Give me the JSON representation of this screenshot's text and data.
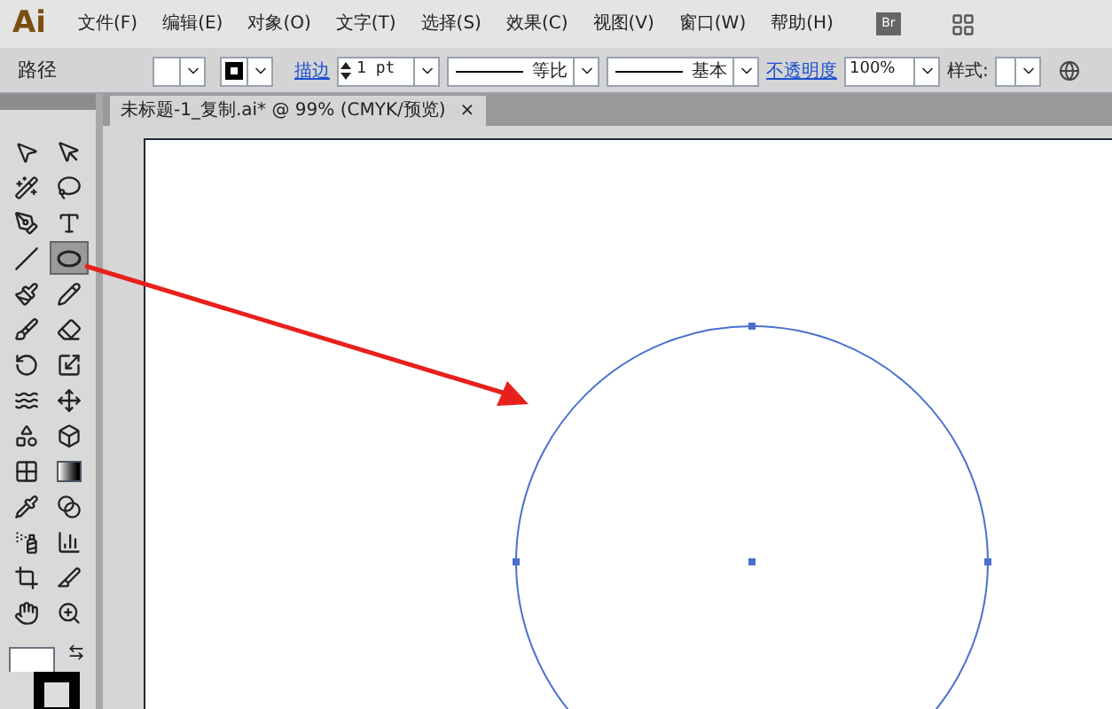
{
  "app_logo": "Ai",
  "menu": [
    "文件(F)",
    "编辑(E)",
    "对象(O)",
    "文字(T)",
    "选择(S)",
    "效果(C)",
    "视图(V)",
    "窗口(W)",
    "帮助(H)"
  ],
  "bridge_button": "Br",
  "control_bar": {
    "selection_label": "路径",
    "stroke_link": "描边",
    "stroke_weight": "1 pt",
    "profile": "等比",
    "brush": "基本",
    "opacity_link": "不透明度",
    "opacity": "100%",
    "style_label": "样式:"
  },
  "document_tab": {
    "title": "未标题-1_复制.ai* @ 99% (CMYK/预览)",
    "close": "×",
    "selected": true
  },
  "tools": [
    {
      "kind": "selection",
      "selected": false
    },
    {
      "kind": "direct-selection",
      "selected": false
    },
    {
      "kind": "magic-wand",
      "selected": false
    },
    {
      "kind": "lasso",
      "selected": false
    },
    {
      "kind": "pen",
      "selected": false
    },
    {
      "kind": "type",
      "selected": false
    },
    {
      "kind": "line",
      "selected": false
    },
    {
      "kind": "ellipse",
      "selected": true
    },
    {
      "kind": "paintbrush",
      "selected": false
    },
    {
      "kind": "pencil",
      "selected": false
    },
    {
      "kind": "blob-brush",
      "selected": false
    },
    {
      "kind": "eraser",
      "selected": false
    },
    {
      "kind": "rotate",
      "selected": false
    },
    {
      "kind": "scale",
      "selected": false
    },
    {
      "kind": "warp",
      "selected": false
    },
    {
      "kind": "free-transform",
      "selected": false
    },
    {
      "kind": "shape-builder",
      "selected": false
    },
    {
      "kind": "perspective",
      "selected": false
    },
    {
      "kind": "mesh",
      "selected": false
    },
    {
      "kind": "gradient",
      "selected": false
    },
    {
      "kind": "eyedropper",
      "selected": false
    },
    {
      "kind": "blend",
      "selected": false
    },
    {
      "kind": "symbol-sprayer",
      "selected": false
    },
    {
      "kind": "graph",
      "selected": false
    },
    {
      "kind": "artboard",
      "selected": false
    },
    {
      "kind": "slice",
      "selected": false
    },
    {
      "kind": "hand",
      "selected": false
    },
    {
      "kind": "zoom",
      "selected": false
    }
  ]
}
